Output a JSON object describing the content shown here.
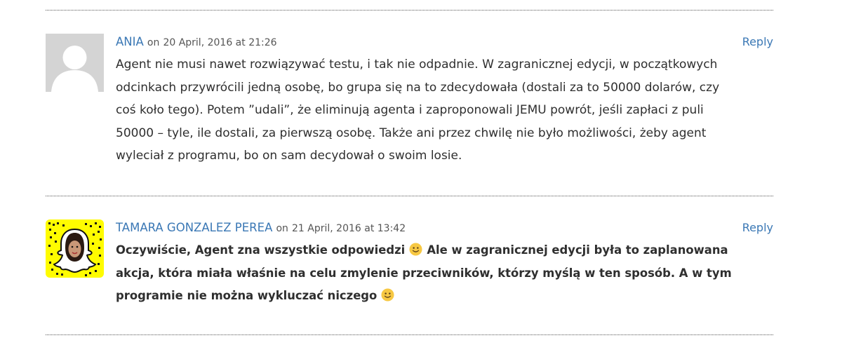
{
  "comments": [
    {
      "author": "ANIA",
      "on_word": "on",
      "date": "20 April, 2016 at 21:26",
      "reply_label": "Reply",
      "lines": [
        "Agent nie musi nawet rozwiązywać testu, i tak nie odpadnie. W zagranicznej edycji, w początkowych",
        "odcinkach przywrócili jedną osobę, bo grupa się na to zdecydowała (dostali za to 50000 dolarów, czy",
        "coś koło tego). Potem ”udali”, że eliminują agenta i zaproponowali JEMU powrót, jeśli zapłaci z puli",
        "50000 – tyle, ile dostali, za pierwszą osobę. Także ani przez chwilę nie było możliwości, żeby agent",
        "wyleciał z programu, bo on sam decydował o swoim losie."
      ],
      "avatar_icon": "default-user-avatar"
    },
    {
      "author": "TAMARA GONZALEZ PEREA",
      "on_word": "on",
      "date": "21 April, 2016 at 13:42",
      "reply_label": "Reply",
      "line1_a": "Oczywiście, Agent zna wszystkie odpowiedzi",
      "line1_b": "Ale w zagranicznej edycji była to zaplanowana",
      "line2": "akcja, która miała właśnie na celu zmylenie przeciwników, którzy myślą w ten sposób. A w tym",
      "line3": "programie nie można wykluczać niczego",
      "avatar_icon": "snapchat-avatar",
      "emoji": "smiley-emoji"
    }
  ],
  "colors": {
    "link": "#3b78b5",
    "text": "#2f2f2f",
    "snap_yellow": "#fffc00"
  }
}
